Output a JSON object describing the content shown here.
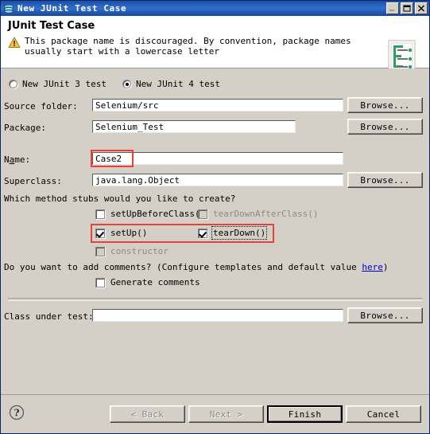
{
  "window": {
    "title": "New JUnit Test Case",
    "icon": "junit-wizard-icon",
    "controls": {
      "minimize": "minimize-button",
      "maximize": "maximize-button",
      "close": "close-button"
    }
  },
  "header": {
    "title": "JUnit Test Case",
    "status_icon": "warning-icon",
    "message": "This package name is discouraged. By convention, package names usually start with a lowercase letter",
    "banner_icon": "junit-document-icon"
  },
  "version": {
    "junit3": {
      "label": "New JUnit 3 test",
      "selected": false
    },
    "junit4": {
      "label": "New JUnit 4 test",
      "selected": true
    }
  },
  "fields": {
    "source_folder": {
      "label": "Source folder:",
      "value": "Selenium/src",
      "browse": "Browse..."
    },
    "package": {
      "label": "Package:",
      "value": "Selenium_Test",
      "browse": "Browse..."
    },
    "name": {
      "label": "Name:",
      "value": "Case2",
      "highlighted": true
    },
    "superclass": {
      "label": "Superclass:",
      "value": "java.lang.Object",
      "browse": "Browse..."
    },
    "class_under_test": {
      "label": "Class under test:",
      "value": "",
      "browse": "Browse..."
    }
  },
  "stubs": {
    "prompt": "Which method stubs would you like to create?",
    "setUpBeforeClass": {
      "label": "setUpBeforeClass()",
      "checked": false,
      "enabled": true
    },
    "tearDownAfterClass": {
      "label": "tearDownAfterClass()",
      "checked": false,
      "enabled": false
    },
    "setUp": {
      "label": "setUp()",
      "checked": true,
      "enabled": true
    },
    "tearDown": {
      "label": "tearDown()",
      "checked": true,
      "enabled": true,
      "focused": true
    },
    "constructor": {
      "label": "constructor",
      "checked": false,
      "enabled": false
    }
  },
  "comments": {
    "prompt_before": "Do you want to add comments? (Configure templates and default value ",
    "link": "here",
    "prompt_after": ")",
    "generate": {
      "label": "Generate comments",
      "checked": false
    }
  },
  "footer": {
    "help": "help-button",
    "back": {
      "label": "< Back",
      "enabled": false
    },
    "next": {
      "label": "Next >",
      "enabled": false
    },
    "finish": {
      "label": "Finish",
      "enabled": true,
      "default": true
    },
    "cancel": {
      "label": "Cancel",
      "enabled": true
    }
  },
  "colors": {
    "dialog_bg": "#d4d0c8",
    "title_bar": "#1c4fa1",
    "header_bg": "#ffffff",
    "highlight_red": "#e8413c",
    "link_blue": "#0000cc",
    "disabled_text": "#8b8a85"
  }
}
